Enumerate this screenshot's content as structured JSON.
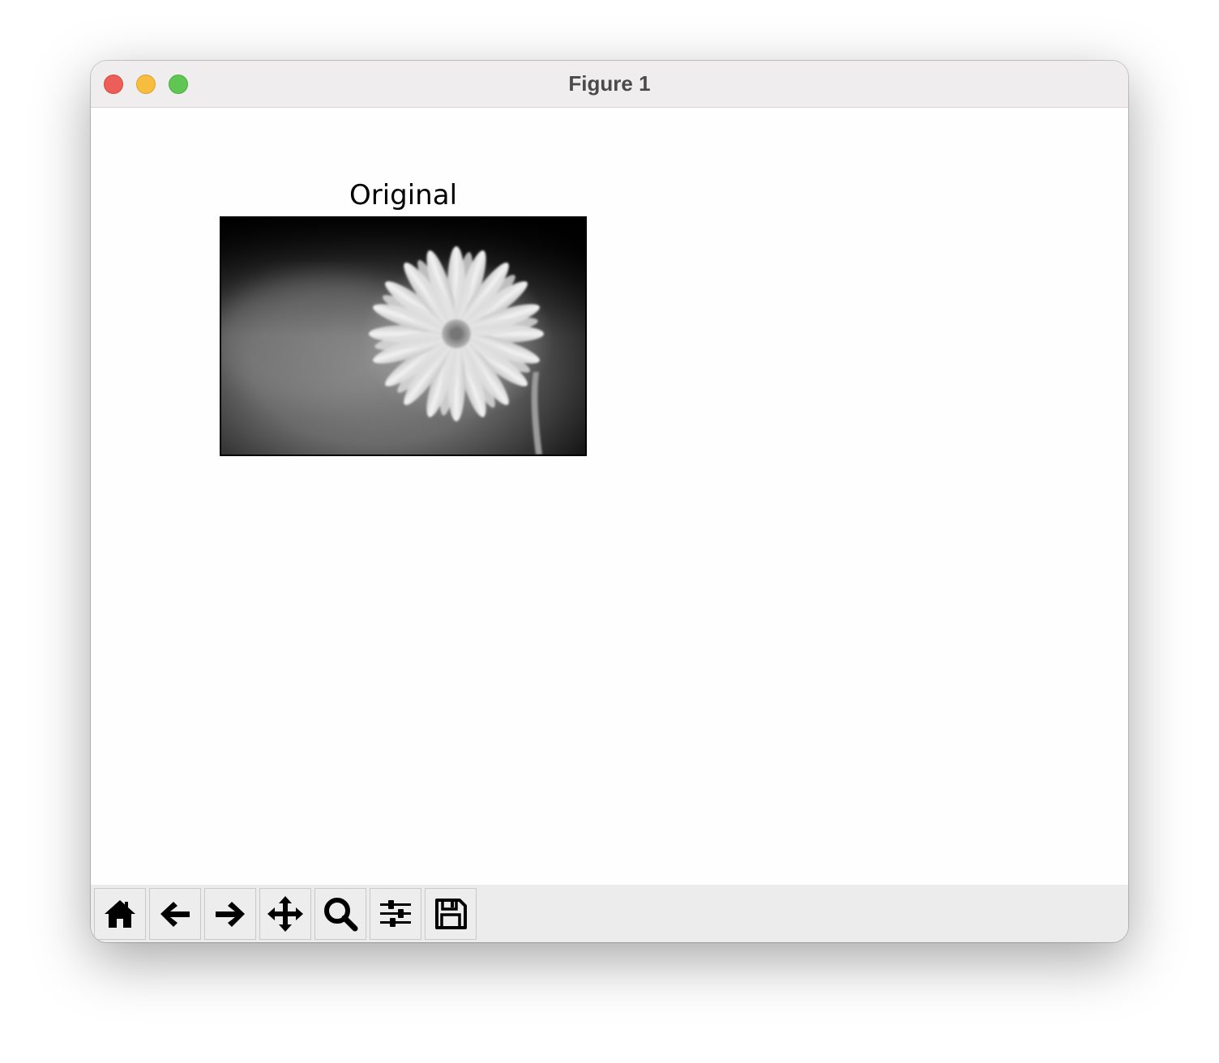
{
  "window": {
    "title": "Figure 1"
  },
  "figure": {
    "axes_title": "Original",
    "image": "grayscale photo of a daisy flower"
  },
  "toolbar": {
    "buttons": [
      {
        "name": "home",
        "icon": "home-icon"
      },
      {
        "name": "back",
        "icon": "arrow-left-icon"
      },
      {
        "name": "forward",
        "icon": "arrow-right-icon"
      },
      {
        "name": "pan",
        "icon": "move-icon"
      },
      {
        "name": "zoom",
        "icon": "magnifier-icon"
      },
      {
        "name": "configure-subplots",
        "icon": "sliders-icon"
      },
      {
        "name": "save",
        "icon": "floppy-disk-icon"
      }
    ]
  },
  "colors": {
    "close": "#ee5e58",
    "minimize": "#f6bd3f",
    "zoom": "#5fc653",
    "titlebar": "#efeded",
    "toolbar": "#ececec"
  }
}
